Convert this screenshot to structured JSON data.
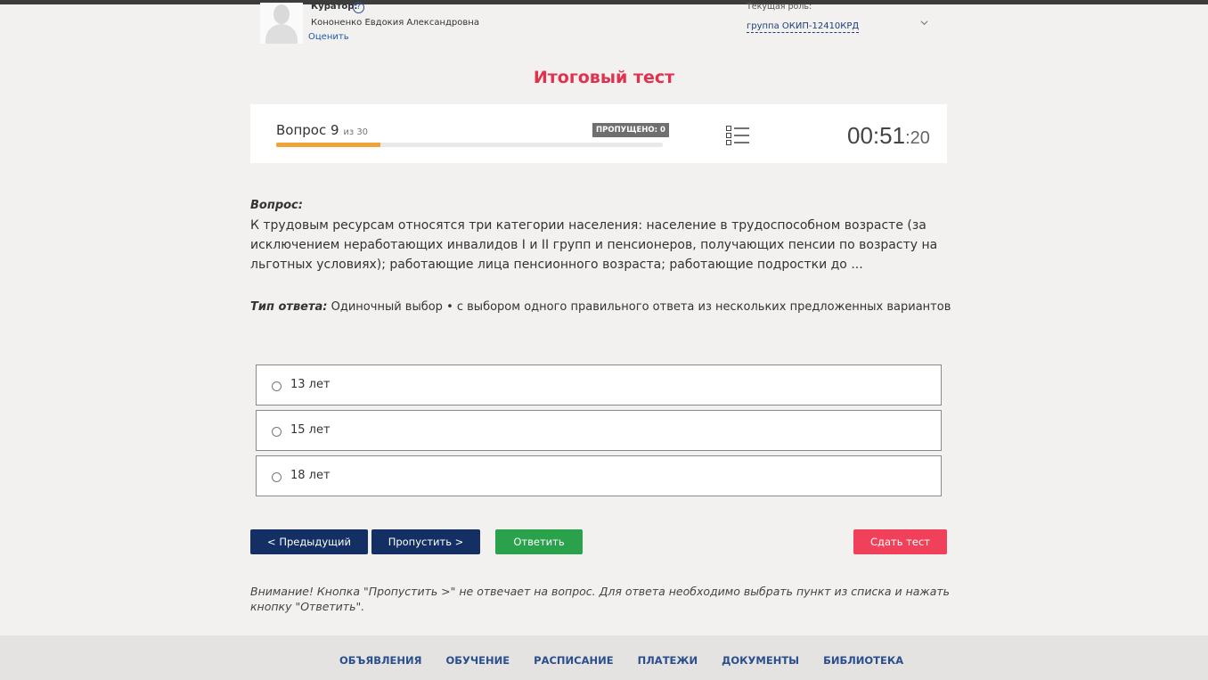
{
  "header": {
    "curator_label": "Куратор:",
    "help_icon": "?",
    "curator_name": "Кононенко Евдокия Александровна",
    "rate_link": "Оценить",
    "role_label": "Текущая роль:",
    "role_value": "группа ОКИП-12410КРД"
  },
  "page_title": "Итоговый тест",
  "progress": {
    "question_label": "Вопрос 9",
    "of_label": "из 30",
    "skipped_badge": "ПРОПУЩЕНО: 0",
    "progress_fraction": 0.27,
    "timer_main": "00:51",
    "timer_sep": ":",
    "timer_seconds": "20"
  },
  "question": {
    "heading": "Вопрос:",
    "text": "К трудовым ресурсам относятся три категории населения: население в трудоспособном возрасте (за исключением неработающих инвалидов I и II групп и пенсионеров, получающих пенсии по возрасту на льготных условиях); работающие лица пенсионного возраста; работающие подростки до ...",
    "answer_type_label": "Тип ответа:",
    "answer_type_value": "Одиночный выбор • с выбором одного правильного ответа из нескольких предложенных вариантов"
  },
  "options": [
    {
      "label": "13 лет"
    },
    {
      "label": "15 лет"
    },
    {
      "label": "18 лет"
    }
  ],
  "buttons": {
    "prev": "< Предыдущий",
    "skip": "Пропустить >",
    "answer": "Ответить",
    "submit": "Сдать тест"
  },
  "warning": "Внимание! Кнопка \"Пропустить >\" не отвечает на вопрос. Для ответа необходимо выбрать пункт из списка и нажать кнопку \"Ответить\".",
  "footer": {
    "items": [
      "ОБЪЯВЛЕНИЯ",
      "ОБУЧЕНИЕ",
      "РАСПИСАНИЕ",
      "ПЛАТЕЖИ",
      "ДОКУМЕНТЫ",
      "БИБЛИОТЕКА"
    ]
  },
  "colors": {
    "title": "#e0314e",
    "progress": "#f0a336",
    "primary_button": "#132f63",
    "answer_button": "#2aa14b",
    "submit_button": "#f0405a"
  }
}
